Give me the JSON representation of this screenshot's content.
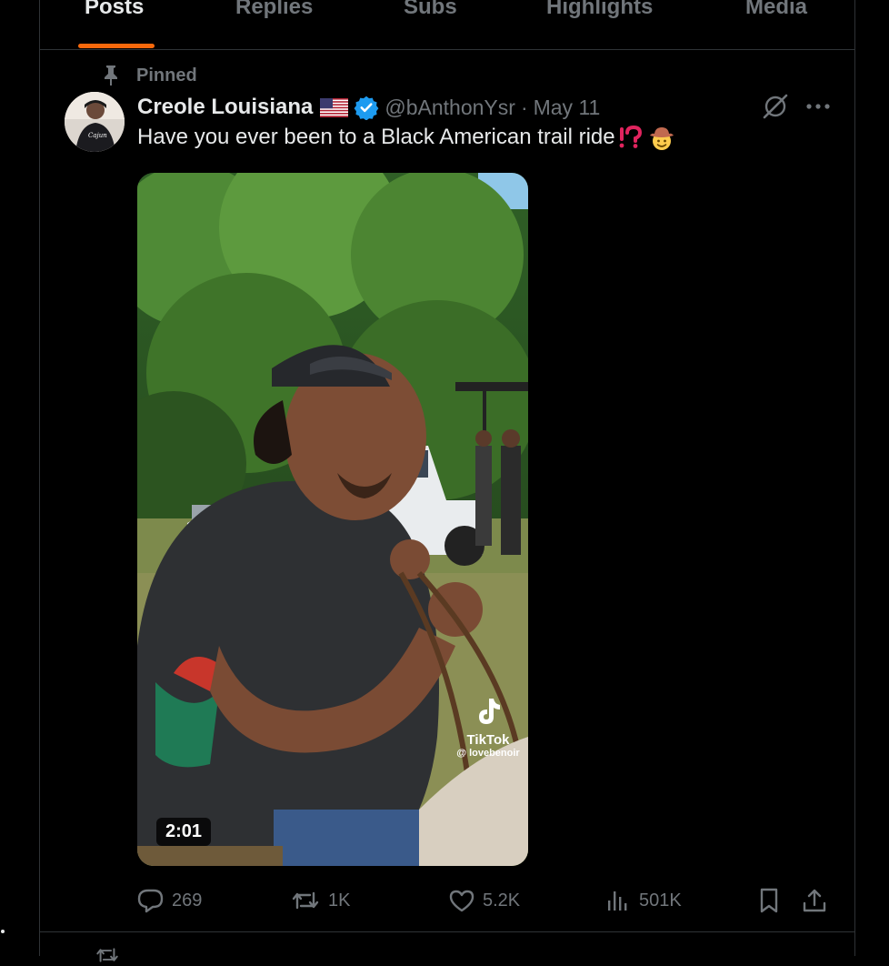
{
  "tabs": [
    {
      "label": "Posts",
      "active": true
    },
    {
      "label": "Replies",
      "active": false
    },
    {
      "label": "Subs",
      "active": false
    },
    {
      "label": "Highlights",
      "active": false
    },
    {
      "label": "Media",
      "active": false
    }
  ],
  "accent_color": "#f7680b",
  "post": {
    "pinned_label": "Pinned",
    "author_name": "Creole Louisiana",
    "handle": "@bAnthonYsr",
    "separator": "·",
    "date": "May 11",
    "text": "Have you ever been to a Black American trail ride",
    "text_emoji": [
      "exclamation-question-mark",
      "cowboy-face"
    ],
    "media": {
      "duration": "2:01",
      "watermark_brand": "TikTok",
      "watermark_user": "@ lovebenoir"
    },
    "stats": {
      "replies": "269",
      "reposts": "1K",
      "likes": "5.2K",
      "views": "501K"
    }
  }
}
